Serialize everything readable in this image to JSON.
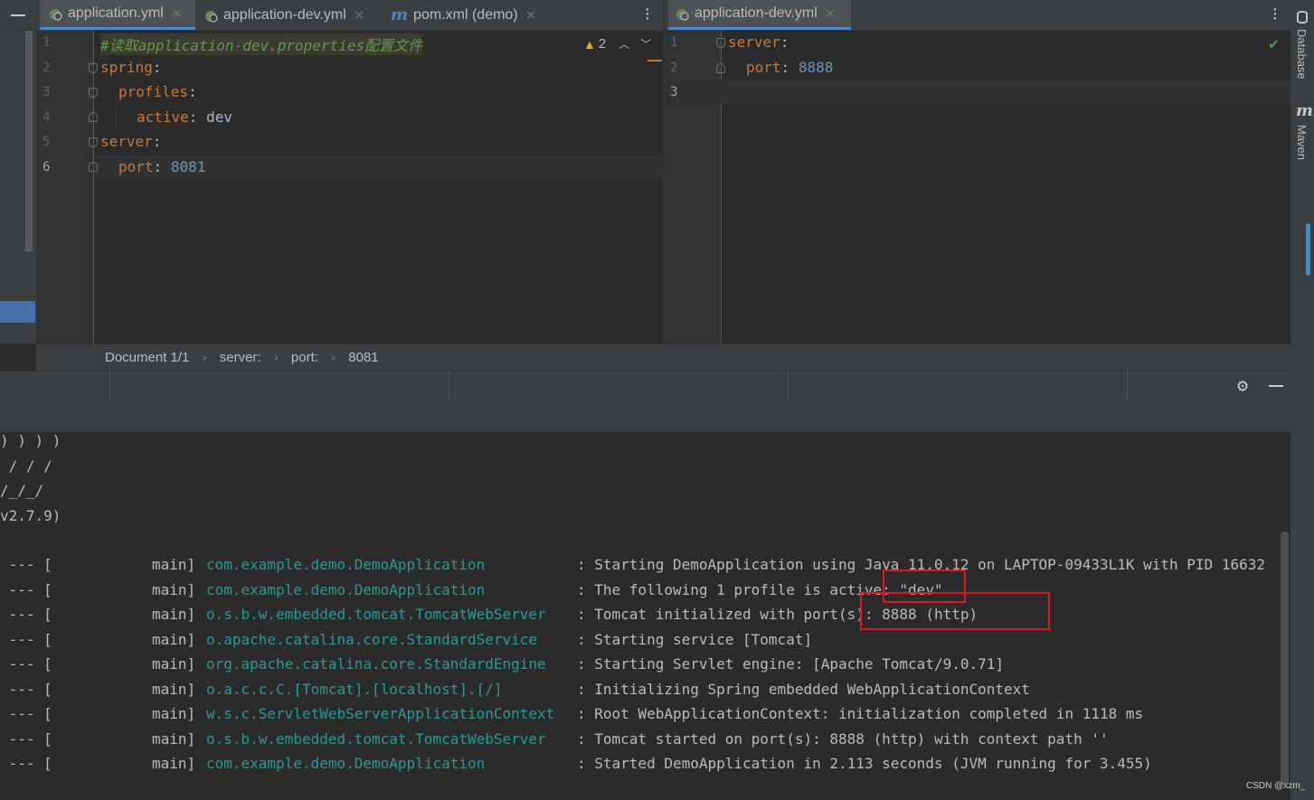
{
  "left_editor": {
    "tabs": [
      {
        "label": "application.yml",
        "icon": "spring-leaf-icon"
      },
      {
        "label": "application-dev.yml",
        "icon": "spring-leaf-icon"
      },
      {
        "label": "pom.xml (demo)",
        "icon": "maven-icon"
      }
    ],
    "line_numbers": [
      "1",
      "2",
      "3",
      "4",
      "5",
      "6"
    ],
    "lines": {
      "l1_comment": "#读取application-dev.properties配置文件",
      "l2_key": "spring",
      "l3_key": "profiles",
      "l4_key": "active",
      "l4_value": "dev",
      "l5_key": "server",
      "l6_key": "port",
      "l6_value": "8081",
      "colon": ":"
    },
    "warnings": "2",
    "breadcrumb": {
      "doc": "Document 1/1",
      "items": [
        "server:",
        "port:",
        "8081"
      ]
    }
  },
  "right_editor": {
    "tab": {
      "label": "application-dev.yml",
      "icon": "spring-leaf-icon"
    },
    "line_numbers": [
      "1",
      "2",
      "3"
    ],
    "lines": {
      "l1_key": "server",
      "l2_key": "port",
      "l2_value": "8888",
      "colon": ":"
    }
  },
  "right_sidebar": {
    "database": "Database",
    "maven": "Maven"
  },
  "console": {
    "banner": [
      ") ) ) )",
      " / / /",
      "/_/_/",
      "v2.7.9)"
    ],
    "logs": [
      {
        "prefix": " --- [",
        "thread": "main]",
        "cls": "com.example.demo.DemoApplication",
        "msg": ": Starting DemoApplication using Java 11.0.12 on LAPTOP-09433L1K with PID 16632"
      },
      {
        "prefix": " --- [",
        "thread": "main]",
        "cls": "com.example.demo.DemoApplication",
        "msg": ": The following 1 profile is active: \"dev\""
      },
      {
        "prefix": " --- [",
        "thread": "main]",
        "cls": "o.s.b.w.embedded.tomcat.TomcatWebServer",
        "msg": ": Tomcat initialized with port(s): 8888 (http)"
      },
      {
        "prefix": " --- [",
        "thread": "main]",
        "cls": "o.apache.catalina.core.StandardService",
        "msg": ": Starting service [Tomcat]"
      },
      {
        "prefix": " --- [",
        "thread": "main]",
        "cls": "org.apache.catalina.core.StandardEngine",
        "msg": ": Starting Servlet engine: [Apache Tomcat/9.0.71]"
      },
      {
        "prefix": " --- [",
        "thread": "main]",
        "cls": "o.a.c.c.C.[Tomcat].[localhost].[/]",
        "msg": ": Initializing Spring embedded WebApplicationContext"
      },
      {
        "prefix": " --- [",
        "thread": "main]",
        "cls": "w.s.c.ServletWebServerApplicationContext",
        "msg": ": Root WebApplicationContext: initialization completed in 1118 ms"
      },
      {
        "prefix": " --- [",
        "thread": "main]",
        "cls": "o.s.b.w.embedded.tomcat.TomcatWebServer",
        "msg": ": Tomcat started on port(s): 8888 (http) with context path ''"
      },
      {
        "prefix": " --- [",
        "thread": "main]",
        "cls": "com.example.demo.DemoApplication",
        "msg": ": Started DemoApplication in 2.113 seconds (JVM running for 3.455)"
      }
    ]
  },
  "watermark": "CSDN @xzm_",
  "colors": {
    "annotation_box": "#e0191e",
    "class_name": "#299999",
    "key": "#cc7832",
    "number": "#6897bb"
  }
}
